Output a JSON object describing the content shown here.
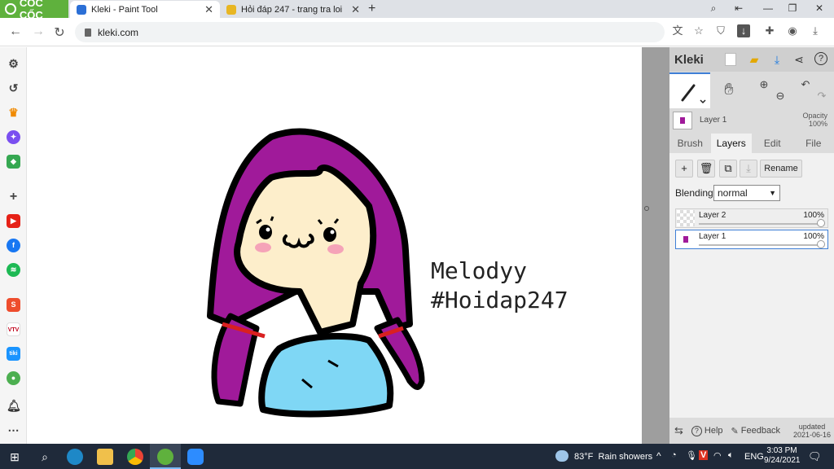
{
  "browser": {
    "brand": "CỐC CỐC",
    "tabs": [
      {
        "title": "Kleki - Paint Tool",
        "active": true
      },
      {
        "title": "Hỏi đáp 247 - trang tra loi",
        "active": false
      }
    ],
    "url": "kleki.com"
  },
  "colors": {
    "brand_green": "#5fb13d",
    "accent_blue": "#3f7fd6",
    "hair_purple": "#a01a9a",
    "skin": "#fdeecb",
    "shirt": "#7fd7f5",
    "taskbar": "#1f2a3a"
  },
  "sidebar_icons": [
    "settings-icon",
    "history-icon",
    "crown-icon",
    "messenger-icon",
    "game-icon",
    "add-icon",
    "youtube-icon",
    "facebook-icon",
    "spotify-icon",
    "shopee-icon",
    "vtv-icon",
    "tiki-icon",
    "maps-icon",
    "bell-icon",
    "more-icon"
  ],
  "drawing": {
    "caption_line1": "Melodyy",
    "caption_line2": "#Hoidap247"
  },
  "kleki": {
    "logo": "Kleki",
    "current_layer": "Layer 1",
    "opacity_label": "Opacity",
    "opacity_value": "100%",
    "tabs": [
      "Brush",
      "Layers",
      "Edit",
      "File"
    ],
    "active_tab": "Layers",
    "rename_label": "Rename",
    "blending_label": "Blending",
    "blending_value": "normal",
    "layers": [
      {
        "name": "Layer 2",
        "opacity": "100%",
        "selected": false
      },
      {
        "name": "Layer 1",
        "opacity": "100%",
        "selected": true
      }
    ],
    "help_label": "Help",
    "feedback_label": "Feedback",
    "updated_label": "updated",
    "updated_date": "2021-06-16"
  },
  "taskbar": {
    "weather": "83°F  Rain showers",
    "lang": "ENG",
    "time": "3:03 PM",
    "date": "9/24/2021"
  }
}
